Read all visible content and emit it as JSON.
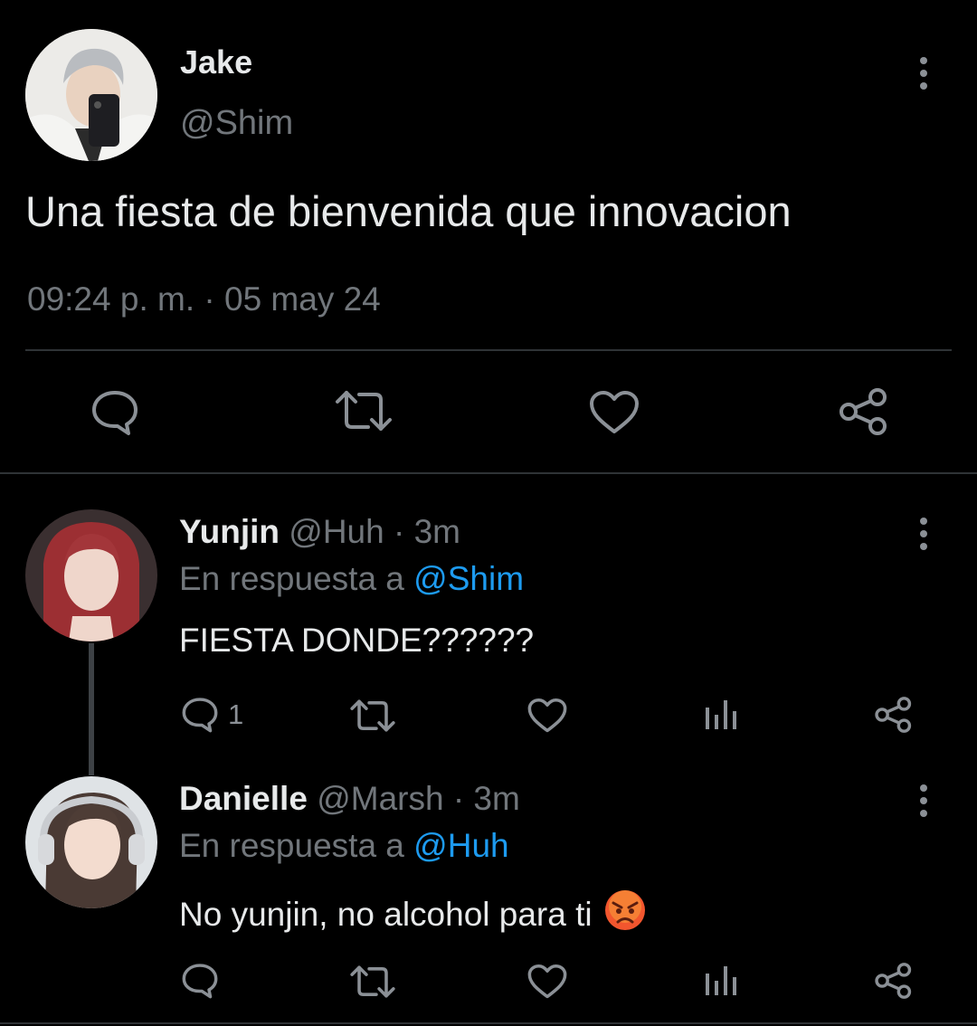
{
  "main_tweet": {
    "display_name": "Jake",
    "handle": "@Shim",
    "text": "Una fiesta de bienvenida que innovacion",
    "timestamp": "09:24 p. m. · 05 may 24",
    "actions": [
      "reply-icon",
      "retweet-icon",
      "like-icon",
      "share-icon"
    ]
  },
  "replies": [
    {
      "display_name": "Yunjin",
      "handle": "@Huh",
      "time": "· 3m",
      "replying_prefix": "En respuesta a",
      "replying_to": "@Shim",
      "text": "FIESTA DONDE??????",
      "reply_count": "1"
    },
    {
      "display_name": "Danielle",
      "handle": "@Marsh",
      "time": "· 3m",
      "replying_prefix": "En respuesta a",
      "replying_to": "@Huh",
      "text": "No yunjin, no alcohol para ti",
      "emoji": "angry-face",
      "reply_count": ""
    }
  ],
  "colors": {
    "background": "#000000",
    "text": "#e7e9ea",
    "muted": "#71767b",
    "link": "#1d9bf0",
    "divider": "#2f3336"
  }
}
